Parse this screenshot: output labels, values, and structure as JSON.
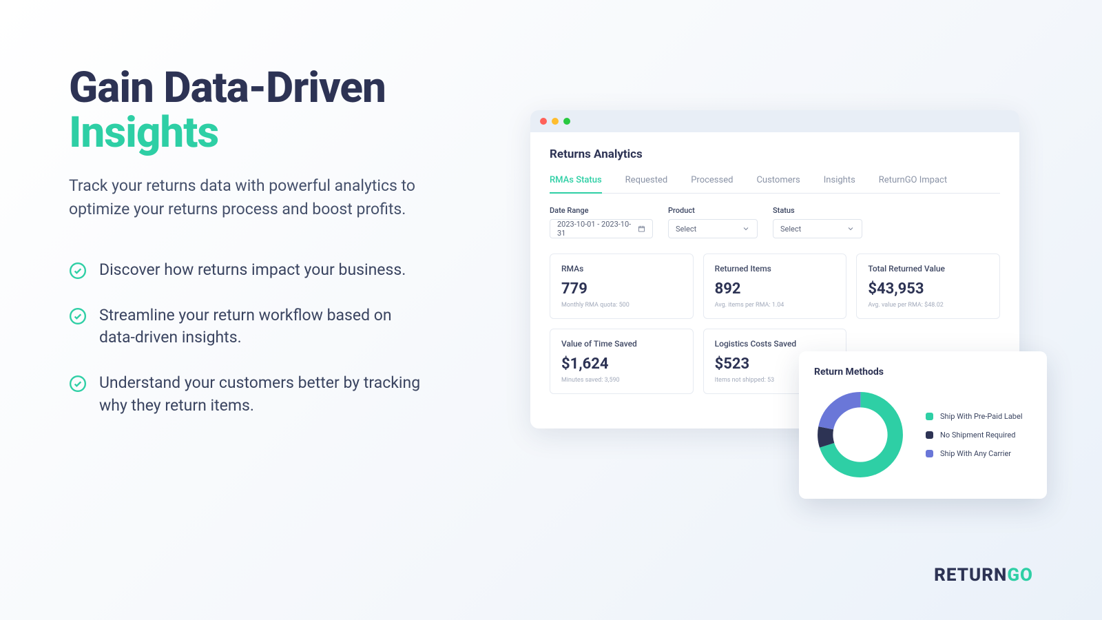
{
  "hero": {
    "title_line1": "Gain Data-Driven",
    "title_line2": "Insights",
    "subtitle": "Track your returns data with powerful analytics to optimize your returns process and boost profits.",
    "bullets": [
      "Discover how returns impact your business.",
      "Streamline your return workflow based on data-driven insights.",
      "Understand your customers better by tracking why they return items."
    ]
  },
  "dashboard": {
    "title": "Returns Analytics",
    "tabs": [
      "RMAs Status",
      "Requested",
      "Processed",
      "Customers",
      "Insights",
      "ReturnGO Impact"
    ],
    "active_tab_index": 0,
    "filters": {
      "date_label": "Date Range",
      "date_value": "2023-10-01 - 2023-10-31",
      "product_label": "Product",
      "product_value": "Select",
      "status_label": "Status",
      "status_value": "Select"
    },
    "cards": [
      {
        "label": "RMAs",
        "value": "779",
        "sub": "Monthly RMA quota: 500"
      },
      {
        "label": "Returned Items",
        "value": "892",
        "sub": "Avg. items per RMA: 1.04"
      },
      {
        "label": "Total Returned Value",
        "value": "$43,953",
        "sub": "Avg. value per RMA: $48.02"
      },
      {
        "label": "Value of Time Saved",
        "value": "$1,624",
        "sub": "Minutes saved: 3,590"
      },
      {
        "label": "Logistics Costs Saved",
        "value": "$523",
        "sub": "Items not shipped: 53"
      }
    ]
  },
  "return_methods": {
    "title": "Return Methods",
    "legend": [
      {
        "label": "Ship With Pre-Paid Label",
        "color": "#2ecfa5"
      },
      {
        "label": "No Shipment Required",
        "color": "#2d3354"
      },
      {
        "label": "Ship With Any Carrier",
        "color": "#6a77d8"
      }
    ]
  },
  "brand": {
    "part1": "RETURN",
    "part2": "GO"
  },
  "chart_data": {
    "type": "pie",
    "title": "Return Methods",
    "series": [
      {
        "name": "Ship With Pre-Paid Label",
        "value": 70,
        "color": "#2ecfa5"
      },
      {
        "name": "No Shipment Required",
        "value": 8,
        "color": "#2d3354"
      },
      {
        "name": "Ship With Any Carrier",
        "value": 22,
        "color": "#6a77d8"
      }
    ]
  }
}
